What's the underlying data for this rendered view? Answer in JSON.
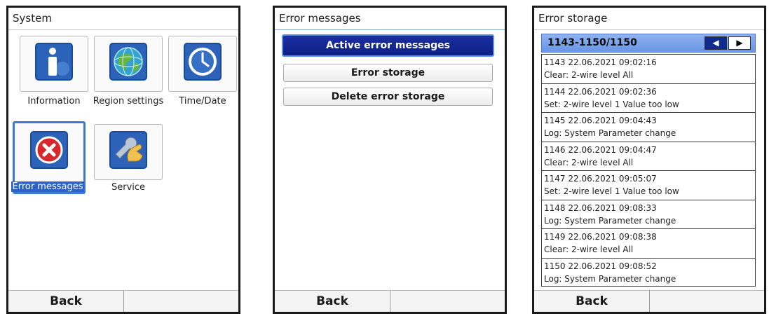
{
  "screen1": {
    "title": "System",
    "tiles": [
      {
        "label": "Information",
        "icon": "information-icon"
      },
      {
        "label": "Region settings",
        "icon": "globe-icon"
      },
      {
        "label": "Time/Date",
        "icon": "clock-icon"
      },
      {
        "label": "Error messages",
        "icon": "error-icon"
      },
      {
        "label": "Service",
        "icon": "service-icon"
      }
    ],
    "back": "Back"
  },
  "screen2": {
    "title": "Error messages",
    "buttons": [
      "Active error messages",
      "Error storage",
      "Delete error storage"
    ],
    "back": "Back"
  },
  "screen3": {
    "title": "Error storage",
    "range": "1143-1150/1150",
    "entries": [
      {
        "head": "1143 22.06.2021 09:02:16",
        "text": "Clear: 2-wire level All"
      },
      {
        "head": "1144 22.06.2021 09:02:36",
        "text": "Set: 2-wire level 1 Value too low"
      },
      {
        "head": "1145 22.06.2021 09:04:43",
        "text": "Log: System Parameter change"
      },
      {
        "head": "1146 22.06.2021 09:04:47",
        "text": "Clear: 2-wire level All"
      },
      {
        "head": "1147 22.06.2021 09:05:07",
        "text": "Set: 2-wire level 1 Value too low"
      },
      {
        "head": "1148 22.06.2021 09:08:33",
        "text": "Log: System Parameter change"
      },
      {
        "head": "1149 22.06.2021 09:08:38",
        "text": "Clear: 2-wire level All"
      },
      {
        "head": "1150 22.06.2021 09:08:52",
        "text": "Log: System Parameter change"
      }
    ],
    "back": "Back"
  },
  "colors": {
    "accent": "#2d63c8",
    "active_button": "#0e1f86",
    "nav_bar": "#7aa2ea"
  }
}
